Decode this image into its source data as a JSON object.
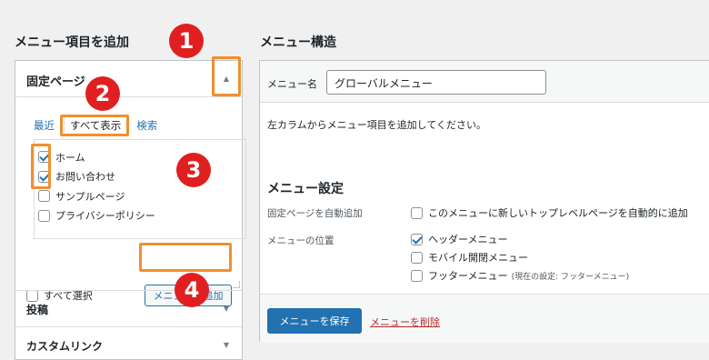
{
  "left": {
    "title": "メニュー項目を追加",
    "panel": {
      "title": "固定ページ",
      "tabs": [
        {
          "label": "最近",
          "active": false
        },
        {
          "label": "すべて表示",
          "active": true
        },
        {
          "label": "検索",
          "active": false
        }
      ],
      "items": [
        {
          "label": "ホーム",
          "checked": true
        },
        {
          "label": "お問い合わせ",
          "checked": true
        },
        {
          "label": "サンプルページ",
          "checked": false
        },
        {
          "label": "プライバシーポリシー",
          "checked": false
        }
      ],
      "select_all": "すべて選択",
      "add_button": "メニューに追加"
    },
    "collapsed": [
      {
        "label": "投稿"
      },
      {
        "label": "カスタムリンク"
      }
    ]
  },
  "right": {
    "title": "メニュー構造",
    "name_label": "メニュー名",
    "name_value": "グローバルメニュー",
    "instruction": "左カラムからメニュー項目を追加してください。",
    "settings": {
      "title": "メニュー設定",
      "auto_add_label": "固定ページを自動追加",
      "auto_add_option": "このメニューに新しいトップレベルページを自動的に追加",
      "location_label": "メニューの位置",
      "locations": [
        {
          "label": "ヘッダーメニュー",
          "checked": true,
          "hint": ""
        },
        {
          "label": "モバイル開閉メニュー",
          "checked": false,
          "hint": ""
        },
        {
          "label": "フッターメニュー",
          "checked": false,
          "hint": "(現在の設定: フッターメニュー)"
        }
      ]
    },
    "save_button": "メニューを保存",
    "delete_link": "メニューを削除"
  },
  "annotations": {
    "steps": [
      "1",
      "2",
      "3",
      "4"
    ],
    "highlight_color": "#f0902e",
    "badge_color": "#e02020"
  },
  "colors": {
    "accent": "#2271b1",
    "danger": "#b32d2e"
  }
}
